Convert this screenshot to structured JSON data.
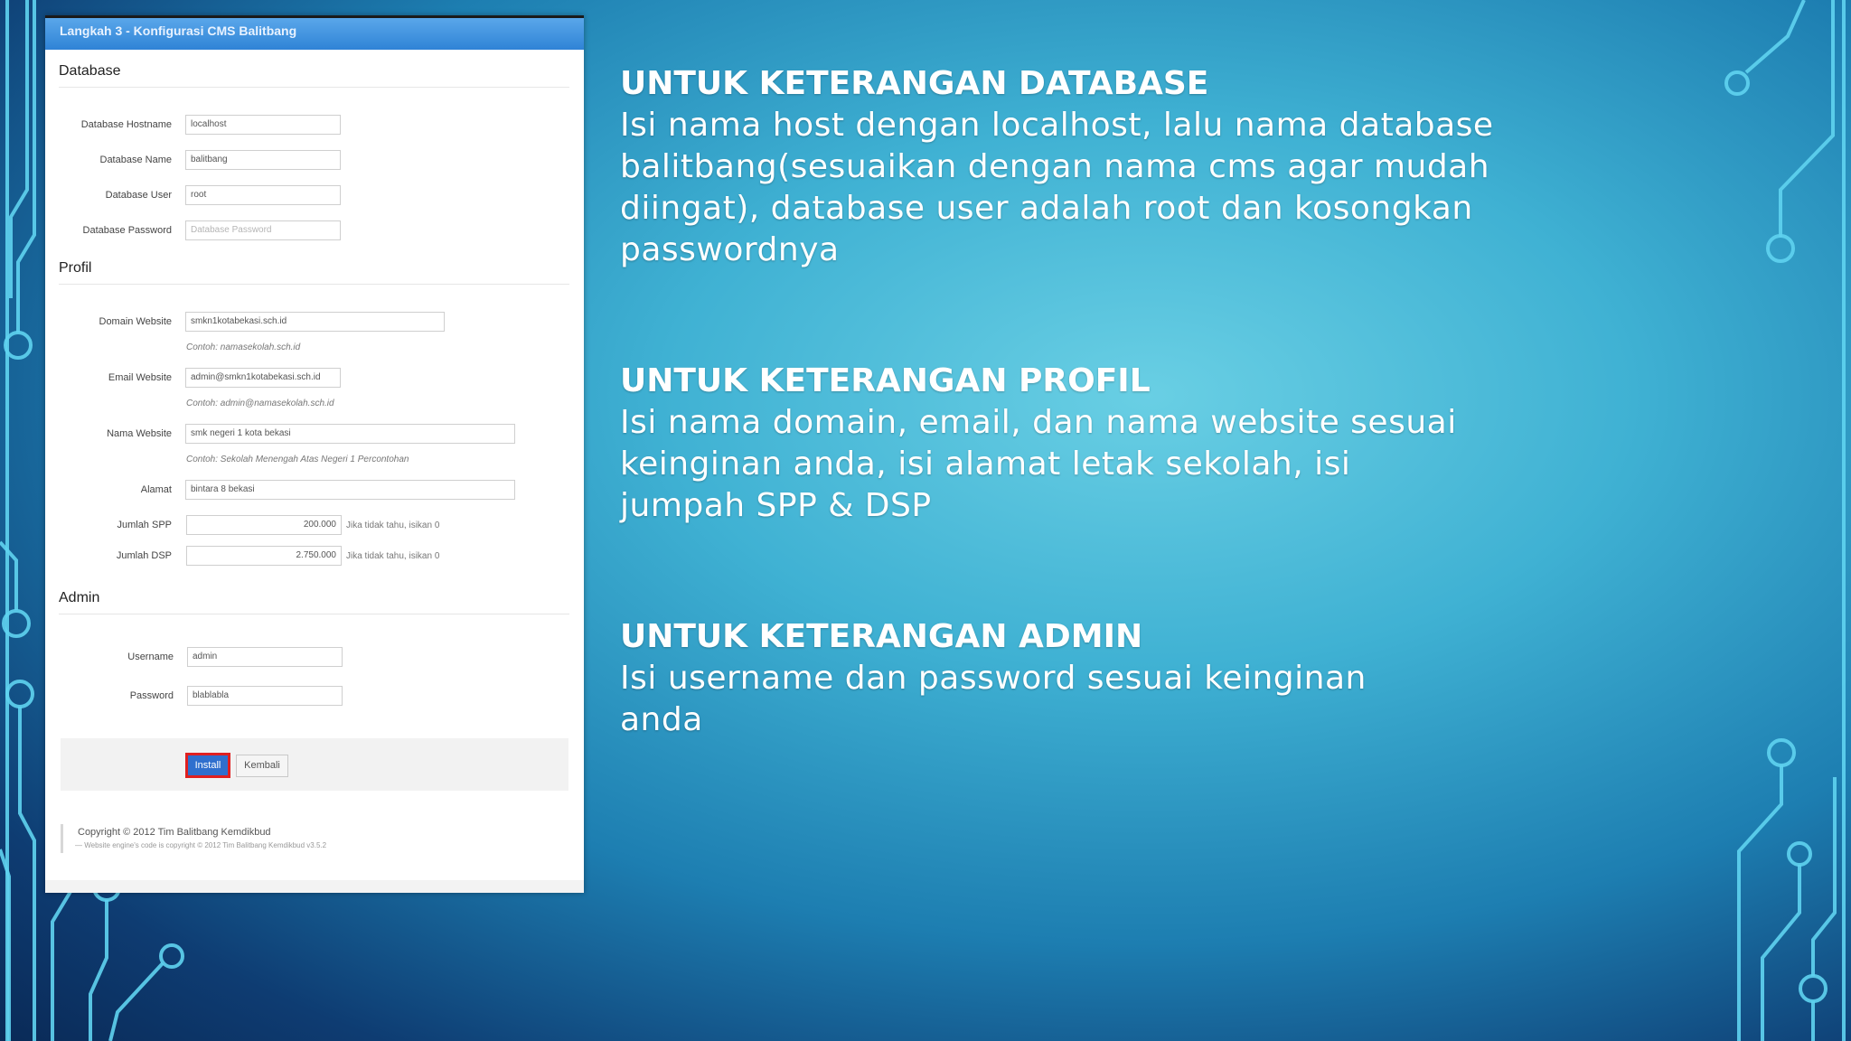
{
  "form": {
    "header": "Langkah 3 - Konfigurasi CMS Balitbang",
    "sections": {
      "database": "Database",
      "profil": "Profil",
      "admin": "Admin"
    },
    "database": {
      "hostname_label": "Database Hostname",
      "hostname_value": "localhost",
      "name_label": "Database Name",
      "name_value": "balitbang",
      "user_label": "Database User",
      "user_value": "root",
      "password_label": "Database Password",
      "password_placeholder": "Database Password"
    },
    "profil": {
      "domain_label": "Domain Website",
      "domain_value": "smkn1kotabekasi.sch.id",
      "domain_hint": "Contoh: namasekolah.sch.id",
      "email_label": "Email Website",
      "email_value": "admin@smkn1kotabekasi.sch.id",
      "email_hint": "Contoh: admin@namasekolah.sch.id",
      "nama_label": "Nama Website",
      "nama_value": "smk negeri 1 kota bekasi",
      "nama_hint": "Contoh: Sekolah Menengah Atas Negeri 1 Percontohan",
      "alamat_label": "Alamat",
      "alamat_value": "bintara 8 bekasi",
      "spp_label": "Jumlah SPP",
      "spp_value": "200.000",
      "spp_hint": "Jika tidak tahu, isikan 0",
      "dsp_label": "Jumlah DSP",
      "dsp_value": "2.750.000",
      "dsp_hint": "Jika tidak tahu, isikan 0"
    },
    "admin": {
      "username_label": "Username",
      "username_value": "admin",
      "password_label": "Password",
      "password_value": "blablabla"
    },
    "buttons": {
      "install": "Install",
      "kembali": "Kembali"
    },
    "footer": {
      "copyright": "Copyright © 2012 Tim Balitbang Kemdikbud",
      "engine": "— Website engine's code is copyright © 2012 Tim Balitbang Kemdikbud v3.5.2"
    }
  },
  "slide": {
    "database": {
      "title": "UNTUK KETERANGAN DATABASE",
      "lines": [
        "Isi nama host dengan localhost, lalu nama database",
        "balitbang(sesuaikan dengan nama cms agar mudah",
        "diingat), database user adalah root dan kosongkan",
        "passwordnya"
      ]
    },
    "profil": {
      "title": "UNTUK KETERANGAN PROFIL",
      "lines": [
        "Isi nama domain, email, dan nama website sesuai",
        "keinginan anda, isi alamat letak sekolah, isi",
        "jumpah SPP & DSP"
      ]
    },
    "admin": {
      "title": "UNTUK KETERANGAN ADMIN",
      "lines": [
        "Isi username dan password sesuai keinginan",
        "anda"
      ]
    }
  }
}
